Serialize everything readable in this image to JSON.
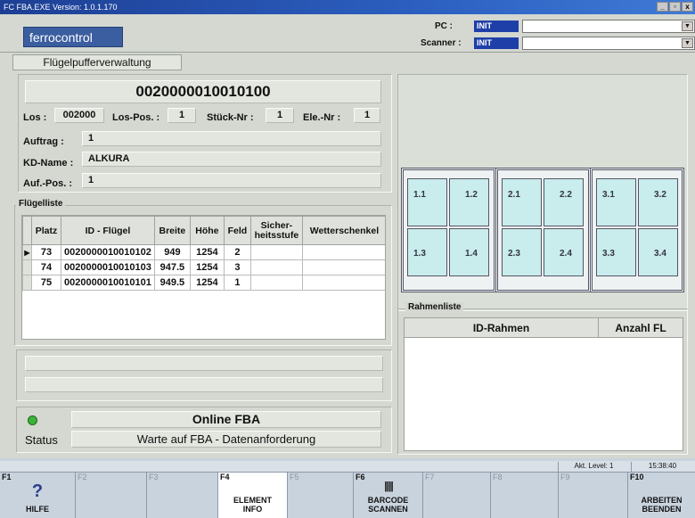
{
  "window": {
    "title": "FC  FBA.EXE   Version: 1.0.1.170",
    "controls": [
      "_",
      "▫",
      "x"
    ]
  },
  "header": {
    "logo": "ferrocontrol",
    "pc_label": "PC :",
    "pc_value": "INIT",
    "scanner_label": "Scanner :",
    "scanner_value": "INIT"
  },
  "tab": {
    "label": "Flügelpufferverwaltung"
  },
  "order": {
    "id": "0020000010010100",
    "los_label": "Los :",
    "los_value": "002000",
    "lospos_label": "Los-Pos. :",
    "lospos_value": "1",
    "stueck_label": "Stück-Nr :",
    "stueck_value": "1",
    "ele_label": "Ele.-Nr :",
    "ele_value": "1",
    "auftrag_label": "Auftrag :",
    "auftrag_value": "1",
    "kdname_label": "KD-Name :",
    "kdname_value": "ALKURA",
    "aufpos_label": "Auf.-Pos. :",
    "aufpos_value": "1"
  },
  "fluegelliste": {
    "title": "Flügelliste",
    "columns": [
      "Platz",
      "ID - Flügel",
      "Breite",
      "Höhe",
      "Feld",
      "Sicher-\nheitsstufe",
      "Wetterschenkel"
    ],
    "rows": [
      [
        "73",
        "0020000010010102",
        "949",
        "1254",
        "2",
        "",
        ""
      ],
      [
        "74",
        "0020000010010103",
        "947.5",
        "1254",
        "3",
        "",
        ""
      ],
      [
        "75",
        "0020000010010101",
        "949.5",
        "1254",
        "1",
        "",
        ""
      ]
    ]
  },
  "window_diagram": {
    "cells": [
      "1.1",
      "1.2",
      "1.3",
      "1.4",
      "2.1",
      "2.2",
      "2.3",
      "2.4",
      "3.1",
      "3.2",
      "3.3",
      "3.4"
    ]
  },
  "rahmenliste": {
    "title": "Rahmenliste",
    "columns": [
      "ID-Rahmen",
      "Anzahl FL"
    ]
  },
  "status": {
    "online": "Online FBA",
    "status_label": "Status",
    "status_text": "Warte auf FBA - Datenanforderung",
    "indicator_color": "#3cb43c"
  },
  "statusbar": {
    "level": "Akt. Level: 1",
    "time": "15:38:40"
  },
  "fkeys": [
    {
      "key": "F1",
      "label": "HILFE",
      "icon": "?"
    },
    {
      "key": "F2",
      "label": ""
    },
    {
      "key": "F3",
      "label": ""
    },
    {
      "key": "F4",
      "label": "ELEMENT\nINFO"
    },
    {
      "key": "F5",
      "label": ""
    },
    {
      "key": "F6",
      "label": "BARCODE\nSCANNEN",
      "icon": "||||"
    },
    {
      "key": "F7",
      "label": ""
    },
    {
      "key": "F8",
      "label": ""
    },
    {
      "key": "F9",
      "label": ""
    },
    {
      "key": "F10",
      "label": "ARBEITEN\nBEENDEN"
    }
  ]
}
